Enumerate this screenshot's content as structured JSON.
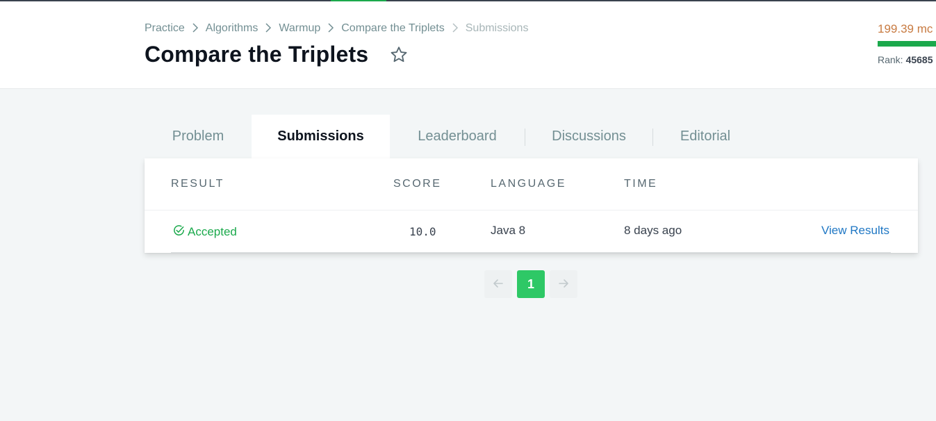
{
  "breadcrumb": {
    "items": [
      "Practice",
      "Algorithms",
      "Warmup",
      "Compare the Triplets"
    ],
    "current": "Submissions"
  },
  "page": {
    "title": "Compare the Triplets"
  },
  "profile": {
    "points": "199.39 mc",
    "rank_label": "Rank:",
    "rank_value": "45685"
  },
  "tabs": [
    {
      "label": "Problem",
      "active": false
    },
    {
      "label": "Submissions",
      "active": true
    },
    {
      "label": "Leaderboard",
      "active": false
    },
    {
      "label": "Discussions",
      "active": false
    },
    {
      "label": "Editorial",
      "active": false
    }
  ],
  "table": {
    "headers": {
      "result": "RESULT",
      "score": "SCORE",
      "language": "LANGUAGE",
      "time": "TIME"
    },
    "rows": [
      {
        "result": "Accepted",
        "score": "10.0",
        "language": "Java 8",
        "time": "8 days ago",
        "action": "View Results"
      }
    ]
  },
  "pagination": {
    "prev": "←",
    "current": "1",
    "next": "→"
  },
  "icons": {
    "breadcrumb_sep": "chevron-right-icon",
    "favorite": "star-outline-icon",
    "accepted": "check-circle-icon"
  },
  "colors": {
    "accent_green": "#1ba94c",
    "pager_green": "#2ec866",
    "link_blue": "#1f77c4",
    "points_orange": "#c87b42",
    "title_dark": "#0e141e"
  }
}
